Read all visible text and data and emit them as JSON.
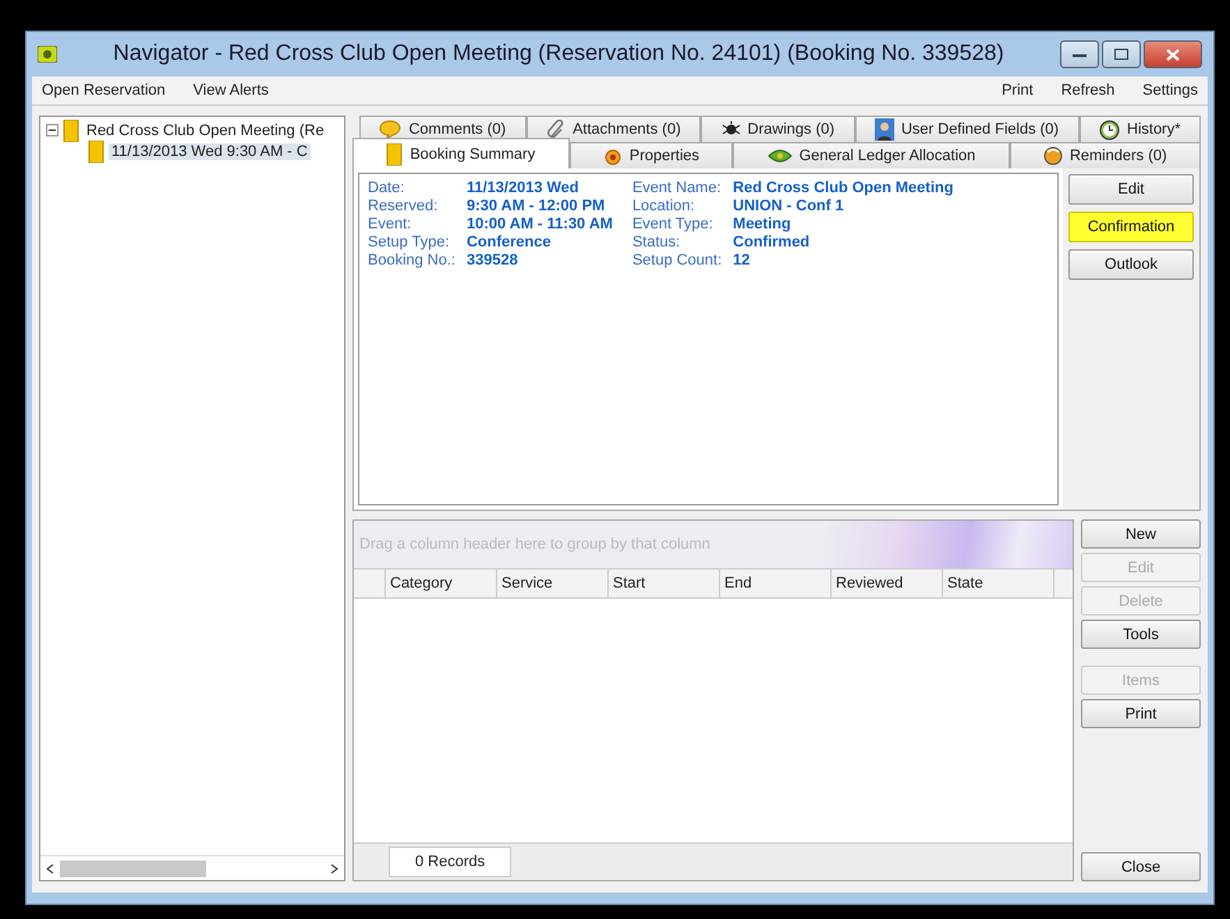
{
  "window": {
    "title": "Navigator - Red Cross Club Open Meeting (Reservation No. 24101) (Booking No. 339528)"
  },
  "menu": {
    "left": [
      "Open Reservation",
      "View Alerts"
    ],
    "right": [
      "Print",
      "Refresh",
      "Settings"
    ]
  },
  "tree": [
    {
      "label": "Red Cross Club Open Meeting (Re",
      "expanded": true,
      "selected": false,
      "children": [
        {
          "label": "11/13/2013 Wed 9:30 AM - C",
          "selected": true
        }
      ]
    }
  ],
  "tabs_top": [
    {
      "label": "Comments (0)",
      "selected": false
    },
    {
      "label": "Attachments (0)",
      "selected": false
    },
    {
      "label": "Drawings (0)",
      "selected": false
    },
    {
      "label": "User Defined Fields (0)",
      "selected": false
    },
    {
      "label": "History*",
      "selected": false
    }
  ],
  "tabs_bottom": [
    {
      "label": "Booking Summary",
      "selected": true
    },
    {
      "label": "Properties",
      "selected": false
    },
    {
      "label": "General Ledger Allocation",
      "selected": false
    },
    {
      "label": "Reminders (0)",
      "selected": false
    }
  ],
  "summary": {
    "left": [
      {
        "label": "Date:",
        "value": "11/13/2013 Wed"
      },
      {
        "label": "Reserved:",
        "value": "9:30 AM - 12:00 PM"
      },
      {
        "label": "Event:",
        "value": "10:00 AM - 11:30 AM"
      },
      {
        "label": "Setup Type:",
        "value": "Conference"
      },
      {
        "label": "Booking No.:",
        "value": "339528"
      }
    ],
    "right": [
      {
        "label": "Event Name:",
        "value": "Red Cross Club Open Meeting"
      },
      {
        "label": "Location:",
        "value": "UNION - Conf 1"
      },
      {
        "label": "Event Type:",
        "value": "Meeting"
      },
      {
        "label": "Status:",
        "value": "Confirmed"
      },
      {
        "label": "Setup Count:",
        "value": "12"
      }
    ]
  },
  "summary_buttons": [
    {
      "label": "Edit",
      "highlighted": false
    },
    {
      "label": "Confirmation",
      "highlighted": true
    },
    {
      "label": "Outlook",
      "highlighted": false
    }
  ],
  "grid": {
    "group_hint": "Drag a column header here to group by that column",
    "columns": [
      "Category",
      "Service",
      "Start",
      "End",
      "Reviewed",
      "State"
    ],
    "record_count": "0 Records"
  },
  "grid_buttons": [
    {
      "label": "New",
      "disabled": false
    },
    {
      "label": "Edit",
      "disabled": true
    },
    {
      "label": "Delete",
      "disabled": true
    },
    {
      "label": "Tools",
      "disabled": false
    }
  ],
  "grid_buttons_lower": [
    {
      "label": "Items",
      "disabled": true
    },
    {
      "label": "Print",
      "disabled": false
    }
  ],
  "close_button": "Close"
}
